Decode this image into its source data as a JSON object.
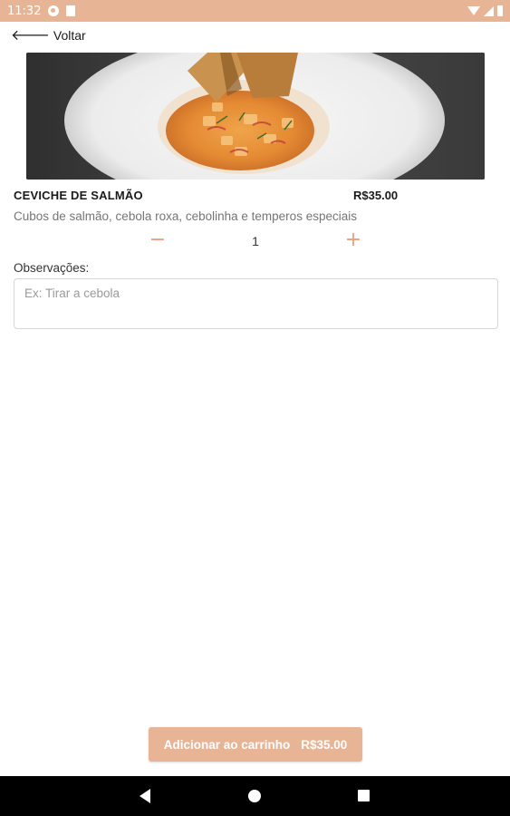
{
  "status_bar": {
    "time": "11:32",
    "icons": [
      "notification-icon",
      "sim-card-icon",
      "wifi-icon",
      "signal-icon",
      "battery-icon"
    ],
    "background": "#e8b496"
  },
  "header": {
    "back_icon": "arrow-left-icon",
    "back_label": "Voltar"
  },
  "product": {
    "name": "CEVICHE DE SALMÃO",
    "price": "R$35.00",
    "description": "Cubos de salmão, cebola roxa, cebolinha e temperos especiais",
    "quantity": "1",
    "minus_symbol": "−",
    "plus_symbol": "+"
  },
  "notes": {
    "label": "Observações:",
    "value": "",
    "placeholder": "Ex: Tirar a cebola"
  },
  "cart_button": {
    "label": "Adicionar ao carrinho",
    "price": "R$35.00"
  },
  "colors": {
    "accent": "#e8b496",
    "stepper": "#e8a07e"
  },
  "nav_bar": {
    "icons": [
      "back-triangle-icon",
      "home-circle-icon",
      "recents-square-icon"
    ]
  }
}
